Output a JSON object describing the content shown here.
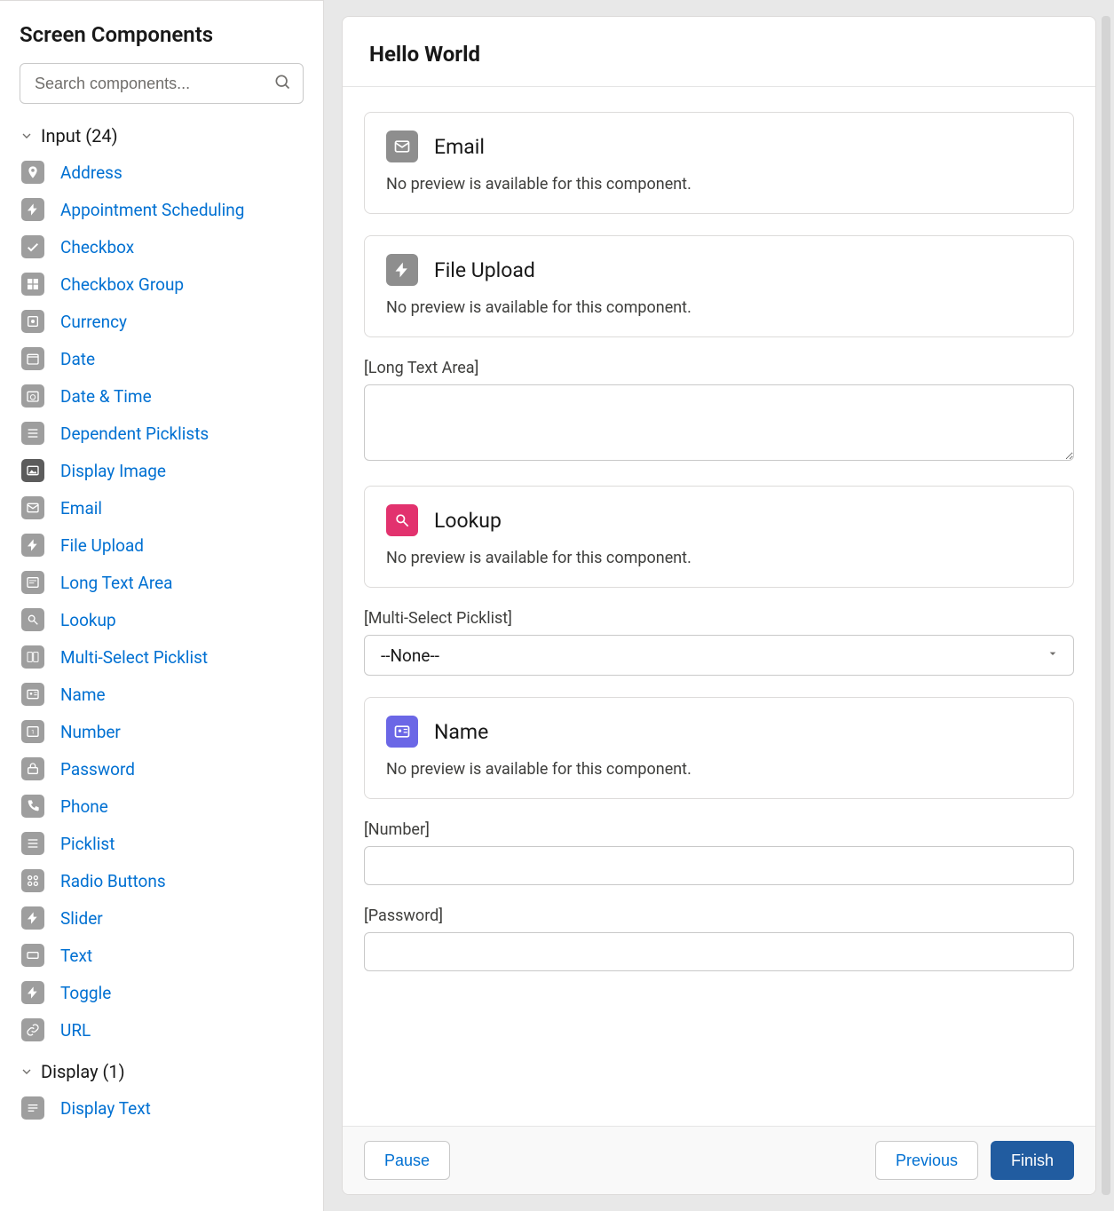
{
  "sidebar": {
    "title": "Screen Components",
    "search_placeholder": "Search components...",
    "categories": [
      {
        "label": "Input (24)",
        "items": [
          {
            "label": "Address",
            "icon": "location"
          },
          {
            "label": "Appointment Scheduling",
            "icon": "bolt"
          },
          {
            "label": "Checkbox",
            "icon": "check"
          },
          {
            "label": "Checkbox Group",
            "icon": "checkgroup"
          },
          {
            "label": "Currency",
            "icon": "currency"
          },
          {
            "label": "Date",
            "icon": "date"
          },
          {
            "label": "Date & Time",
            "icon": "datetime"
          },
          {
            "label": "Dependent Picklists",
            "icon": "list"
          },
          {
            "label": "Display Image",
            "icon": "image",
            "dark": true
          },
          {
            "label": "Email",
            "icon": "email"
          },
          {
            "label": "File Upload",
            "icon": "bolt"
          },
          {
            "label": "Long Text Area",
            "icon": "textarea"
          },
          {
            "label": "Lookup",
            "icon": "lookup"
          },
          {
            "label": "Multi-Select Picklist",
            "icon": "multiselect"
          },
          {
            "label": "Name",
            "icon": "name"
          },
          {
            "label": "Number",
            "icon": "number"
          },
          {
            "label": "Password",
            "icon": "password"
          },
          {
            "label": "Phone",
            "icon": "phone"
          },
          {
            "label": "Picklist",
            "icon": "list"
          },
          {
            "label": "Radio Buttons",
            "icon": "radio"
          },
          {
            "label": "Slider",
            "icon": "bolt"
          },
          {
            "label": "Text",
            "icon": "text"
          },
          {
            "label": "Toggle",
            "icon": "bolt"
          },
          {
            "label": "URL",
            "icon": "url"
          }
        ]
      },
      {
        "label": "Display (1)",
        "items": [
          {
            "label": "Display Text",
            "icon": "displaytext"
          }
        ]
      }
    ]
  },
  "screen": {
    "title": "Hello World",
    "no_preview_msg": "No preview is available for this component.",
    "blocks": [
      {
        "kind": "nopreview",
        "title": "Email",
        "icon": "email",
        "iconColor": "gray"
      },
      {
        "kind": "nopreview",
        "title": "File Upload",
        "icon": "bolt",
        "iconColor": "gray"
      },
      {
        "kind": "textarea",
        "label": "[Long Text Area]"
      },
      {
        "kind": "nopreview",
        "title": "Lookup",
        "icon": "lookup",
        "iconColor": "pink"
      },
      {
        "kind": "select",
        "label": "[Multi-Select Picklist]",
        "value": "--None--"
      },
      {
        "kind": "nopreview",
        "title": "Name",
        "icon": "name",
        "iconColor": "purple"
      },
      {
        "kind": "input",
        "label": "[Number]",
        "inputType": "text"
      },
      {
        "kind": "input",
        "label": "[Password]",
        "inputType": "password"
      }
    ]
  },
  "footer": {
    "pause": "Pause",
    "previous": "Previous",
    "finish": "Finish"
  },
  "icons_svg": {
    "location": "<svg viewBox='0 0 24 24' fill='white'><path d='M12 2C8 2 5 5 5 9c0 5 7 13 7 13s7-8 7-13c0-4-3-7-7-7zm0 9.5A2.5 2.5 0 1 1 12 6a2.5 2.5 0 0 1 0 5.5z'/></svg>",
    "bolt": "<svg viewBox='0 0 24 24' fill='white'><path d='M13 2L3 14h6v8l10-12h-6z'/></svg>",
    "check": "<svg viewBox='0 0 24 24' fill='white'><path d='M9 16l-4-4-2 2 6 6L21 8l-2-2z'/></svg>",
    "checkgroup": "<svg viewBox='0 0 24 24' fill='white'><path d='M3 3h8v8H3zM13 3h8v8h-8zM3 13h8v8H3zM13 13h8v8h-8z'/></svg>",
    "currency": "<svg viewBox='0 0 24 24' fill='white'><rect x='4' y='4' width='16' height='16' rx='2' stroke='white' fill='none' stroke-width='2'/><circle cx='12' cy='12' r='3'/></svg>",
    "date": "<svg viewBox='0 0 24 24' fill='white'><rect x='3' y='5' width='18' height='16' rx='2' fill='none' stroke='white' stroke-width='2'/><line x1='3' y1='9' x2='21' y2='9' stroke='white' stroke-width='2'/></svg>",
    "datetime": "<svg viewBox='0 0 24 24' fill='white'><rect x='3' y='5' width='18' height='16' rx='2' fill='none' stroke='white' stroke-width='2'/><circle cx='12' cy='14' r='4' fill='none' stroke='white' stroke-width='1.5'/></svg>",
    "list": "<svg viewBox='0 0 24 24' fill='white'><rect x='4' y='5' width='16' height='2'/><rect x='4' y='11' width='16' height='2'/><rect x='4' y='17' width='16' height='2'/></svg>",
    "image": "<svg viewBox='0 0 24 24' fill='white'><rect x='3' y='5' width='18' height='14' rx='2' fill='none' stroke='white' stroke-width='2'/><path d='M5 17l5-6 4 4 2-2 3 4z'/></svg>",
    "email": "<svg viewBox='0 0 24 24' fill='white'><rect x='3' y='5' width='18' height='14' rx='2' fill='none' stroke='white' stroke-width='2'/><path d='M3 7l9 6 9-6' fill='none' stroke='white' stroke-width='2'/></svg>",
    "textarea": "<svg viewBox='0 0 24 24' fill='white'><rect x='3' y='4' width='18' height='16' rx='2' fill='none' stroke='white' stroke-width='2'/><line x1='6' y1='9' x2='18' y2='9' stroke='white' stroke-width='1.5'/><line x1='6' y1='13' x2='14' y2='13' stroke='white' stroke-width='1.5'/></svg>",
    "lookup": "<svg viewBox='0 0 24 24' fill='white'><circle cx='10' cy='10' r='5' fill='none' stroke='white' stroke-width='2'/><line x1='14' y1='14' x2='20' y2='20' stroke='white' stroke-width='2'/></svg>",
    "multiselect": "<svg viewBox='0 0 24 24' fill='white'><rect x='3' y='4' width='8' height='16' rx='1' fill='none' stroke='white' stroke-width='1.5'/><rect x='13' y='4' width='8' height='16' rx='1' fill='none' stroke='white' stroke-width='1.5'/></svg>",
    "name": "<svg viewBox='0 0 24 24' fill='white'><rect x='3' y='5' width='18' height='14' rx='2' fill='none' stroke='white' stroke-width='2'/><circle cx='9' cy='11' r='2'/><line x1='14' y1='9' x2='19' y2='9' stroke='white' stroke-width='1.5'/><line x1='14' y1='13' x2='19' y2='13' stroke='white' stroke-width='1.5'/></svg>",
    "number": "<svg viewBox='0 0 24 24' fill='white'><rect x='3' y='4' width='18' height='16' rx='2' fill='none' stroke='white' stroke-width='2'/><text x='12' y='16' font-size='10' text-anchor='middle' fill='white'>1</text></svg>",
    "password": "<svg viewBox='0 0 24 24' fill='white'><rect x='4' y='10' width='16' height='10' rx='2' fill='none' stroke='white' stroke-width='2'/><path d='M8 10V7a4 4 0 0 1 8 0v3' fill='none' stroke='white' stroke-width='2'/></svg>",
    "phone": "<svg viewBox='0 0 24 24' fill='white'><path d='M6 2h4l2 5-3 2a12 12 0 0 0 6 6l2-3 5 2v4a2 2 0 0 1-2 2A18 18 0 0 1 4 4a2 2 0 0 1 2-2z' fill='white'/></svg>",
    "radio": "<svg viewBox='0 0 24 24' fill='white'><circle cx='7' cy='7' r='3' fill='none' stroke='white' stroke-width='2'/><circle cx='7' cy='17' r='3' fill='none' stroke='white' stroke-width='2'/><circle cx='17' cy='7' r='3' fill='none' stroke='white' stroke-width='2'/><circle cx='17' cy='17' r='3' fill='none' stroke='white' stroke-width='2'/></svg>",
    "text": "<svg viewBox='0 0 24 24' fill='white'><rect x='3' y='7' width='18' height='10' rx='2' fill='none' stroke='white' stroke-width='2'/></svg>",
    "url": "<svg viewBox='0 0 24 24' fill='white'><path d='M10 14a5 5 0 0 0 7 0l3-3a5 5 0 0 0-7-7l-1 1' fill='none' stroke='white' stroke-width='2'/><path d='M14 10a5 5 0 0 0-7 0l-3 3a5 5 0 0 0 7 7l1-1' fill='none' stroke='white' stroke-width='2'/></svg>",
    "displaytext": "<svg viewBox='0 0 24 24' fill='white'><rect x='4' y='6' width='16' height='2'/><rect x='4' y='11' width='16' height='2'/><rect x='4' y='16' width='10' height='2'/></svg>"
  }
}
